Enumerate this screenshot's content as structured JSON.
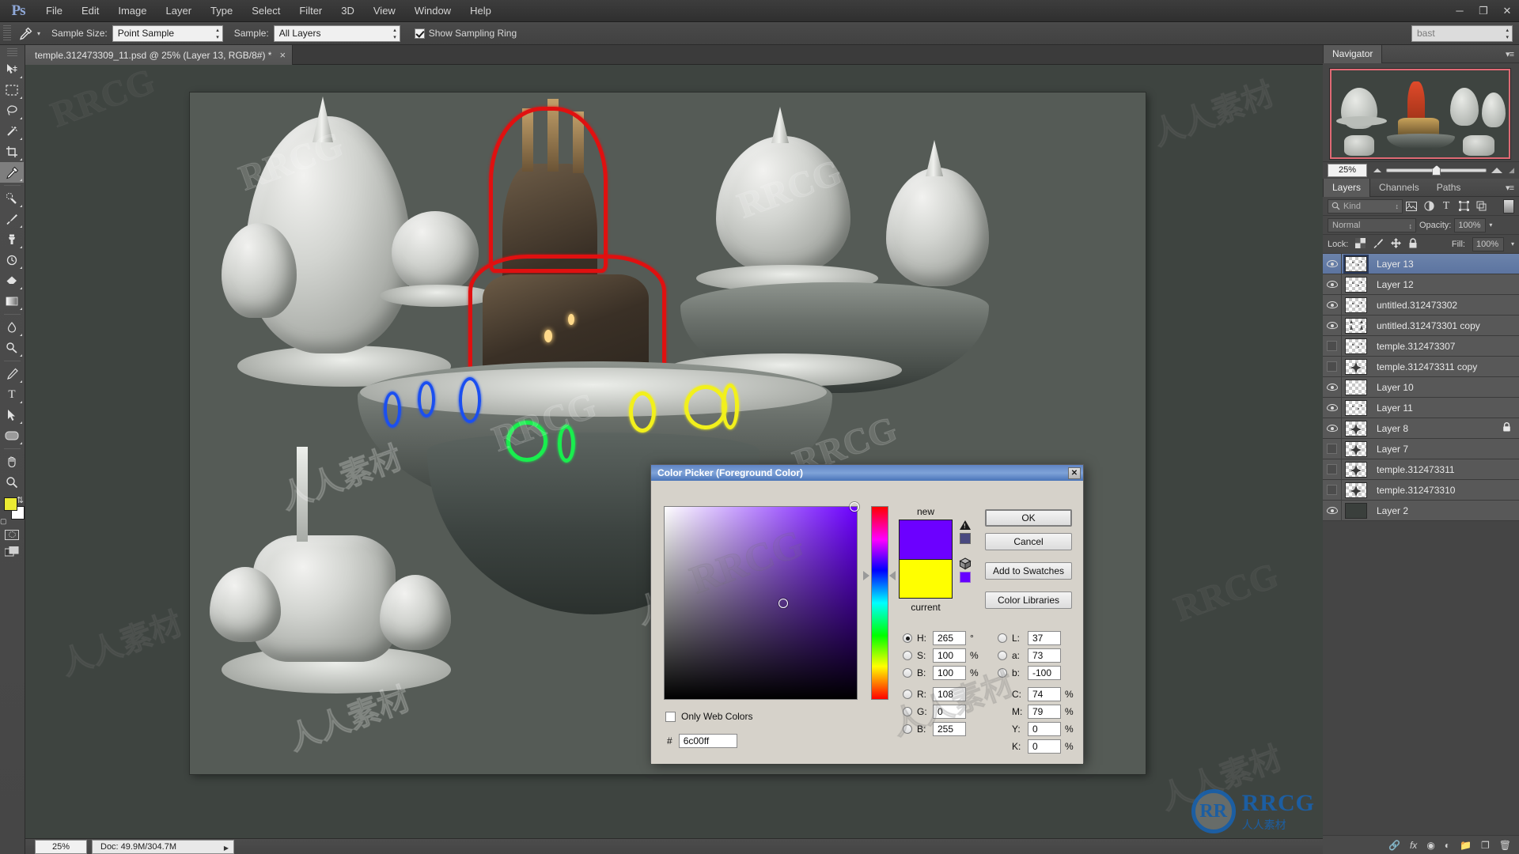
{
  "app": {
    "logo": "Ps",
    "menus": [
      "File",
      "Edit",
      "Image",
      "Layer",
      "Type",
      "Select",
      "Filter",
      "3D",
      "View",
      "Window",
      "Help"
    ],
    "window_controls": {
      "minimize": "─",
      "maximize": "❐",
      "close": "✕"
    }
  },
  "options_bar": {
    "tool_icon": "eyedropper-icon",
    "sample_size_label": "Sample Size:",
    "sample_size_value": "Point Sample",
    "sample_label": "Sample:",
    "sample_value": "All Layers",
    "show_sampling_ring_label": "Show Sampling Ring",
    "show_sampling_ring_checked": true,
    "workspace_value": "bast"
  },
  "toolbox": {
    "tools": [
      {
        "name": "move-tool",
        "glyph": "➤",
        "active": false
      },
      {
        "name": "rectangular-marquee-tool",
        "glyph": "⬚",
        "active": false
      },
      {
        "name": "lasso-tool",
        "glyph": "❦",
        "active": false
      },
      {
        "name": "magic-wand-tool",
        "glyph": "✸",
        "active": false
      },
      {
        "name": "crop-tool",
        "glyph": "⛌",
        "active": false
      },
      {
        "name": "eyedropper-tool",
        "glyph": "✒",
        "active": true
      },
      {
        "name": "spot-healing-brush-tool",
        "glyph": "✍",
        "active": false
      },
      {
        "name": "brush-tool",
        "glyph": "✐",
        "active": false
      },
      {
        "name": "clone-stamp-tool",
        "glyph": "⚓",
        "active": false
      },
      {
        "name": "history-brush-tool",
        "glyph": "↺",
        "active": false
      },
      {
        "name": "eraser-tool",
        "glyph": "▬",
        "active": false
      },
      {
        "name": "gradient-tool",
        "glyph": "◧",
        "active": false
      },
      {
        "name": "blur-tool",
        "glyph": "◖",
        "active": false
      },
      {
        "name": "dodge-tool",
        "glyph": "○",
        "active": false
      },
      {
        "name": "pen-tool",
        "glyph": "✑",
        "active": false
      },
      {
        "name": "horizontal-type-tool",
        "glyph": "T",
        "active": false
      },
      {
        "name": "path-selection-tool",
        "glyph": "▲",
        "active": false
      },
      {
        "name": "rounded-rectangle-tool",
        "glyph": "▭",
        "active": false
      },
      {
        "name": "hand-tool",
        "glyph": "✋",
        "active": false
      },
      {
        "name": "zoom-tool",
        "glyph": "⌕",
        "active": false
      }
    ],
    "foreground_color": "#ebeb33",
    "background_color": "#ffffff"
  },
  "document": {
    "tab_title": "temple.312473309_11.psd @ 25% (Layer 13, RGB/8#) *",
    "close_glyph": "×"
  },
  "status_bar": {
    "zoom": "25%",
    "doc_info": "Doc: 49.9M/304.7M"
  },
  "navigator": {
    "title": "Navigator",
    "zoom_value": "25%"
  },
  "layers_panel": {
    "tabs": [
      {
        "label": "Layers",
        "active": true
      },
      {
        "label": "Channels",
        "active": false
      },
      {
        "label": "Paths",
        "active": false
      }
    ],
    "filter_placeholder": "Kind",
    "filter_icons": [
      "image-filter-icon",
      "adjustment-filter-icon",
      "type-filter-icon",
      "shape-filter-icon",
      "smartobject-filter-icon"
    ],
    "blend_mode": "Normal",
    "opacity_label": "Opacity:",
    "opacity_value": "100%",
    "lock_label": "Lock:",
    "lock_icons": [
      "lock-transparency-icon",
      "lock-image-icon",
      "lock-position-icon",
      "lock-all-icon"
    ],
    "fill_label": "Fill:",
    "fill_value": "100%",
    "layers": [
      {
        "name": "Layer 13",
        "visible": true,
        "selected": true,
        "locked": false,
        "thumb": "transparent-sparse"
      },
      {
        "name": "Layer 12",
        "visible": true,
        "selected": false,
        "locked": false,
        "thumb": "transparent-sparse"
      },
      {
        "name": "untitled.312473302",
        "visible": true,
        "selected": false,
        "locked": false,
        "thumb": "transparent-sparse"
      },
      {
        "name": "untitled.312473301 copy",
        "visible": true,
        "selected": false,
        "locked": false,
        "thumb": "transparent-shapes"
      },
      {
        "name": "temple.312473307",
        "visible": false,
        "selected": false,
        "locked": false,
        "thumb": "transparent-sparse"
      },
      {
        "name": "temple.312473311 copy",
        "visible": false,
        "selected": false,
        "locked": false,
        "thumb": "transparent-star"
      },
      {
        "name": "Layer 10",
        "visible": true,
        "selected": false,
        "locked": false,
        "thumb": "transparent-empty"
      },
      {
        "name": "Layer 11",
        "visible": true,
        "selected": false,
        "locked": false,
        "thumb": "transparent-sparse"
      },
      {
        "name": "Layer 8",
        "visible": true,
        "selected": false,
        "locked": true,
        "thumb": "transparent-star"
      },
      {
        "name": "Layer 7",
        "visible": false,
        "selected": false,
        "locked": false,
        "thumb": "transparent-star"
      },
      {
        "name": "temple.312473311",
        "visible": false,
        "selected": false,
        "locked": false,
        "thumb": "transparent-star"
      },
      {
        "name": "temple.312473310",
        "visible": false,
        "selected": false,
        "locked": false,
        "thumb": "transparent-star"
      },
      {
        "name": "Layer 2",
        "visible": true,
        "selected": false,
        "locked": false,
        "thumb": "solid-dark"
      }
    ],
    "footer_icons": [
      "link-layers-icon",
      "layer-style-icon",
      "layer-mask-icon",
      "adjustment-layer-icon",
      "new-group-icon",
      "new-layer-icon",
      "delete-layer-icon"
    ]
  },
  "color_picker": {
    "title": "Color Picker (Foreground Color)",
    "close_glyph": "✕",
    "new_label": "new",
    "current_label": "current",
    "new_color": "#6c00ff",
    "current_color": "#ffff00",
    "out_of_gamut_swatch": "#4a4a80",
    "web_safe_swatch": "#6600ff",
    "buttons": {
      "ok": "OK",
      "cancel": "Cancel",
      "add_to_swatches": "Add to Swatches",
      "color_libraries": "Color Libraries"
    },
    "only_web_colors_label": "Only Web Colors",
    "only_web_colors_checked": false,
    "hex_prefix": "#",
    "hex_value": "6c00ff",
    "selected_mode": "H",
    "fields": {
      "H": {
        "label": "H:",
        "value": "265",
        "unit": "°"
      },
      "S": {
        "label": "S:",
        "value": "100",
        "unit": "%"
      },
      "B": {
        "label": "B:",
        "value": "100",
        "unit": "%"
      },
      "R": {
        "label": "R:",
        "value": "108",
        "unit": ""
      },
      "G": {
        "label": "G:",
        "value": "0",
        "unit": ""
      },
      "Bb": {
        "label": "B:",
        "value": "255",
        "unit": ""
      },
      "L": {
        "label": "L:",
        "value": "37",
        "unit": ""
      },
      "a": {
        "label": "a:",
        "value": "73",
        "unit": ""
      },
      "b": {
        "label": "b:",
        "value": "-100",
        "unit": ""
      },
      "C": {
        "label": "C:",
        "value": "74",
        "unit": "%"
      },
      "M": {
        "label": "M:",
        "value": "79",
        "unit": "%"
      },
      "Y": {
        "label": "Y:",
        "value": "0",
        "unit": "%"
      },
      "K": {
        "label": "K:",
        "value": "0",
        "unit": "%"
      }
    }
  },
  "watermarks": {
    "rrcg": "RRCG",
    "chinese": "人人素材",
    "logo_initials": "RR",
    "logo_text": "RRCG",
    "logo_subtext": "人人素材"
  }
}
